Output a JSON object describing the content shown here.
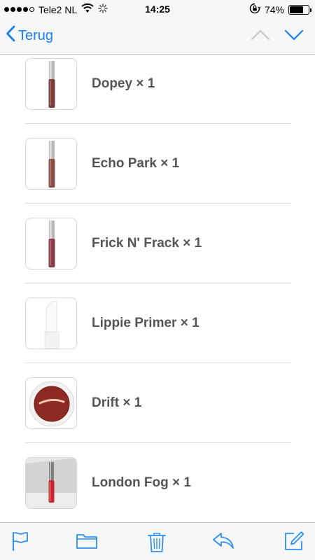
{
  "status_bar": {
    "carrier": "Tele2 NL",
    "time": "14:25",
    "battery_percent": "74%",
    "battery_level": 0.74,
    "signal_bars": 4,
    "signal_total": 5,
    "icons": [
      "wifi-icon",
      "activity-spinner-icon",
      "rotation-lock-icon",
      "battery-icon"
    ]
  },
  "nav": {
    "back_label": "Terug",
    "icons": [
      "chevron-left-icon",
      "chevron-up-icon",
      "chevron-down-icon"
    ]
  },
  "items": [
    {
      "label": "Dopey × 1",
      "thumb": "liquid-lipstick",
      "color": "#7a3b3a"
    },
    {
      "label": "Echo Park × 1",
      "thumb": "liquid-lipstick",
      "color": "#8a5048"
    },
    {
      "label": "Frick N' Frack × 1",
      "thumb": "liquid-lipstick",
      "color": "#8b3c48"
    },
    {
      "label": "Lippie Primer × 1",
      "thumb": "lipstick-bullet",
      "color": "#f4f4f4"
    },
    {
      "label": "Drift × 1",
      "thumb": "eyeshadow-pot",
      "color": "#8e2a24"
    },
    {
      "label": "London Fog × 1",
      "thumb": "liquid-lipstick-photo",
      "color": "#c8262c"
    }
  ],
  "toolbar": {
    "icons": [
      "flag-icon",
      "folder-icon",
      "trash-icon",
      "reply-icon",
      "compose-icon"
    ]
  },
  "colors": {
    "accent": "#157efb",
    "toolbar_icon": "#2b8ff5",
    "inactive_arrow": "#c7c7cc",
    "label": "#555555"
  }
}
